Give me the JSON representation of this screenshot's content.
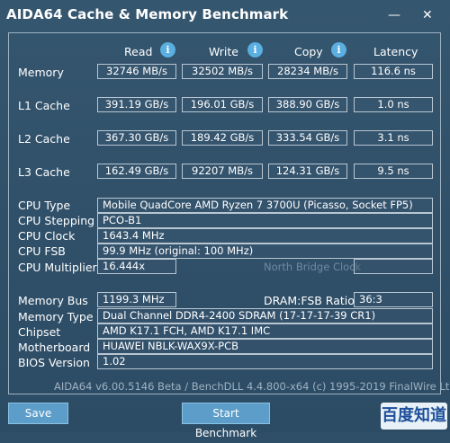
{
  "window": {
    "title": "AIDA64 Cache & Memory Benchmark",
    "minimize": "—",
    "close": "✕"
  },
  "columns": {
    "read": "Read",
    "write": "Write",
    "copy": "Copy",
    "latency": "Latency"
  },
  "rows": [
    {
      "label": "Memory",
      "read": "32746 MB/s",
      "write": "32502 MB/s",
      "copy": "28234 MB/s",
      "latency": "116.6 ns"
    },
    {
      "label": "L1 Cache",
      "read": "391.19 GB/s",
      "write": "196.01 GB/s",
      "copy": "388.90 GB/s",
      "latency": "1.0 ns"
    },
    {
      "label": "L2 Cache",
      "read": "367.30 GB/s",
      "write": "189.42 GB/s",
      "copy": "333.54 GB/s",
      "latency": "3.1 ns"
    },
    {
      "label": "L3 Cache",
      "read": "162.49 GB/s",
      "write": "92207 MB/s",
      "copy": "124.31 GB/s",
      "latency": "9.5 ns"
    }
  ],
  "cpu": {
    "type_label": "CPU Type",
    "type": "Mobile QuadCore AMD Ryzen 7 3700U  (Picasso, Socket FP5)",
    "stepping_label": "CPU Stepping",
    "stepping": "PCO-B1",
    "clock_label": "CPU Clock",
    "clock": "1643.4 MHz",
    "fsb_label": "CPU FSB",
    "fsb": "99.9 MHz  (original: 100 MHz)",
    "multiplier_label": "CPU Multiplier",
    "multiplier": "16.444x",
    "nb_clock_label": "North Bridge Clock"
  },
  "memory": {
    "bus_label": "Memory Bus",
    "bus": "1199.3 MHz",
    "ratio_label": "DRAM:FSB Ratio",
    "ratio": "36:3",
    "type_label": "Memory Type",
    "type": "Dual Channel DDR4-2400 SDRAM  (17-17-17-39 CR1)",
    "chipset_label": "Chipset",
    "chipset": "AMD K17.1 FCH, AMD K17.1 IMC",
    "motherboard_label": "Motherboard",
    "motherboard": "HUAWEI NBLK-WAX9X-PCB",
    "bios_label": "BIOS Version",
    "bios": "1.02"
  },
  "footer": "AIDA64 v6.00.5146 Beta / BenchDLL 4.4.800-x64  (c) 1995-2019 FinalWire Ltd.",
  "buttons": {
    "save": "Save",
    "start": "Start Benchmark"
  },
  "watermark": "百度知道",
  "colors": {
    "background": "#2f4f69",
    "accent": "#5aaee0",
    "button": "#5c9ec9"
  }
}
